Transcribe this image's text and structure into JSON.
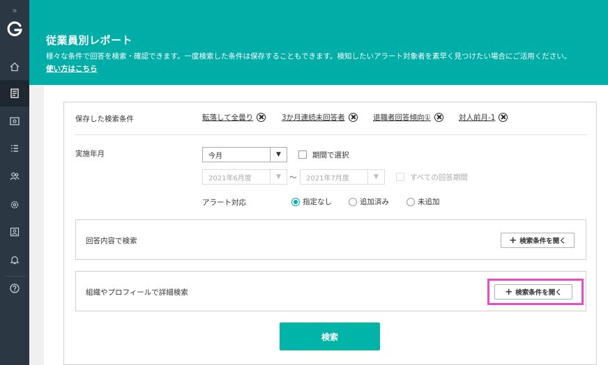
{
  "sidebar": {
    "expand_glyph": "»",
    "items": [
      {
        "icon": "home-icon"
      },
      {
        "icon": "report-icon",
        "active": true
      },
      {
        "icon": "survey-icon"
      },
      {
        "icon": "list-icon"
      },
      {
        "icon": "users-icon"
      },
      {
        "icon": "gear-icon"
      },
      {
        "icon": "person-frame-icon"
      },
      {
        "icon": "bell-icon"
      },
      {
        "icon": "help-icon"
      }
    ]
  },
  "header": {
    "title": "従業員別レポート",
    "description": "様々な条件で回答を検索・確認できます。一度検索した条件は保存することもできます。検知したいアラート対象者を素早く見つけたい場合にご活用ください。",
    "help_link": "使い方はこちら"
  },
  "search": {
    "saved_label": "保存した検索条件",
    "saved_conditions": [
      "転落して全曇り",
      "3か月連続未回答者",
      "退職者回答傾向①",
      "対人前月-1"
    ],
    "period_label": "実施年月",
    "period_select": "今月",
    "period_range_checkbox": "期間で選択",
    "from_select": "2021年6月度",
    "range_sep": "～",
    "to_select": "2021年7月度",
    "all_periods_checkbox": "すべての回答期間",
    "alert_label": "アラート対応",
    "alert_options": [
      "指定なし",
      "追加済み",
      "未追加"
    ],
    "alert_selected": 0,
    "answer_panel_title": "回答内容で検索",
    "org_panel_title": "組織やプロフィールで詳細検索",
    "open_button_label": "検索条件を開く",
    "plus_glyph": "+",
    "search_button": "検索",
    "dropdown_glyph": "▼"
  },
  "colors": {
    "accent": "#00aea8",
    "sidebar": "#2b3742",
    "highlight": "#e94bc8"
  }
}
